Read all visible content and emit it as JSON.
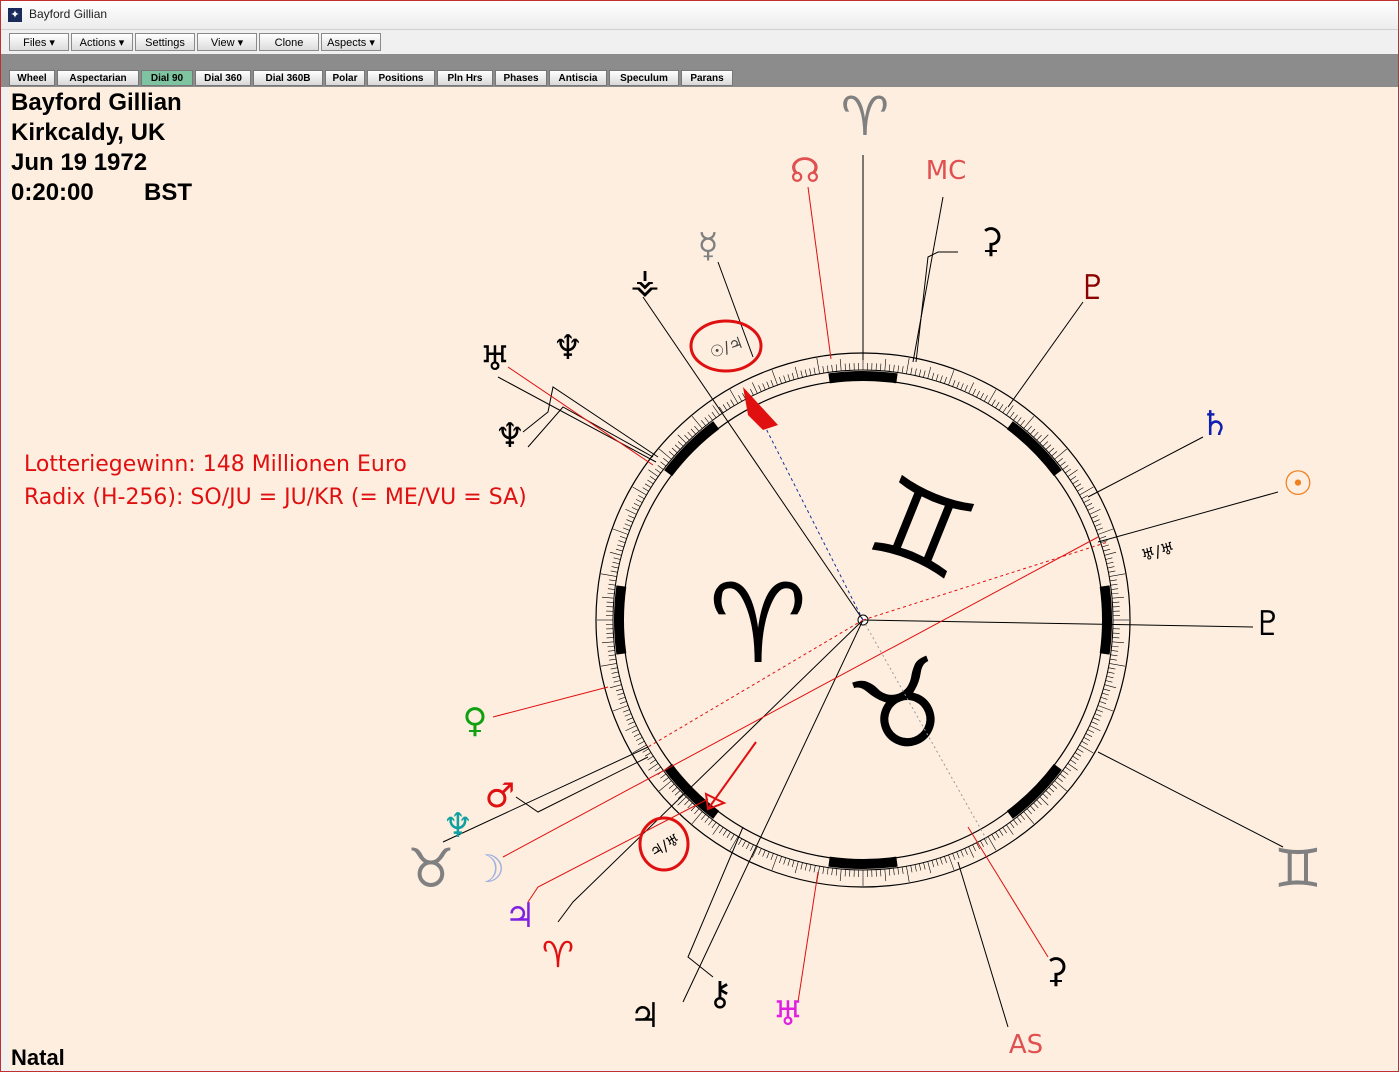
{
  "window": {
    "title": "Bayford Gillian"
  },
  "toolbar": {
    "files": "Files ▾",
    "actions": "Actions ▾",
    "settings": "Settings",
    "view": "View ▾",
    "clone": "Clone",
    "aspects": "Aspects ▾"
  },
  "tabs": [
    "Wheel",
    "Aspectarian",
    "Dial 90",
    "Dial 360",
    "Dial 360B",
    "Polar",
    "Positions",
    "Pln Hrs",
    "Phases",
    "Antiscia",
    "Speculum",
    "Parans"
  ],
  "active_tab": "Dial 90",
  "chart_info": {
    "name": "Bayford Gillian",
    "place": "Kirkcaldy, UK",
    "date": "Jun 19 1972",
    "time": "0:20:00",
    "zone": "BST"
  },
  "annotation": {
    "line1": "Lotteriegewinn: 148 Millionen Euro",
    "line2": "Radix (H-256): SO/JU = JU/KR (= ME/VU = SA)"
  },
  "footer": {
    "chart_type": "Natal"
  },
  "dial": {
    "inner_signs": [
      "♈",
      "♊",
      "♉"
    ],
    "outer_markers": {
      "aries": "♈",
      "taurus": "♉",
      "gemini": "♊"
    },
    "circled_labels": [
      "☉/♃",
      "♃/♅"
    ],
    "ring_label": "♅/♅"
  },
  "points": {
    "node": "☊",
    "mc": "MC",
    "ceres": "⚳",
    "pluto": "♇",
    "saturn": "♄",
    "sun": "☉",
    "mercury_ring": "☿",
    "mercury": "☿",
    "venus": "♀",
    "mars": "♂",
    "neptune": "♆",
    "moon": "☽",
    "jupiter": "♃",
    "aries_point": "♈",
    "kronos": "♅",
    "chiron": "⚷",
    "uranus": "♅",
    "as": "AS",
    "admetos": "♆",
    "apollon": "⚶",
    "zeus": "♃",
    "vulcanus": "⚳",
    "poseidon": "♆",
    "hades": "♇"
  },
  "colors": {
    "accent_red": "#e01010",
    "active_tab": "#7fc4a0",
    "background": "#fdeee0"
  }
}
